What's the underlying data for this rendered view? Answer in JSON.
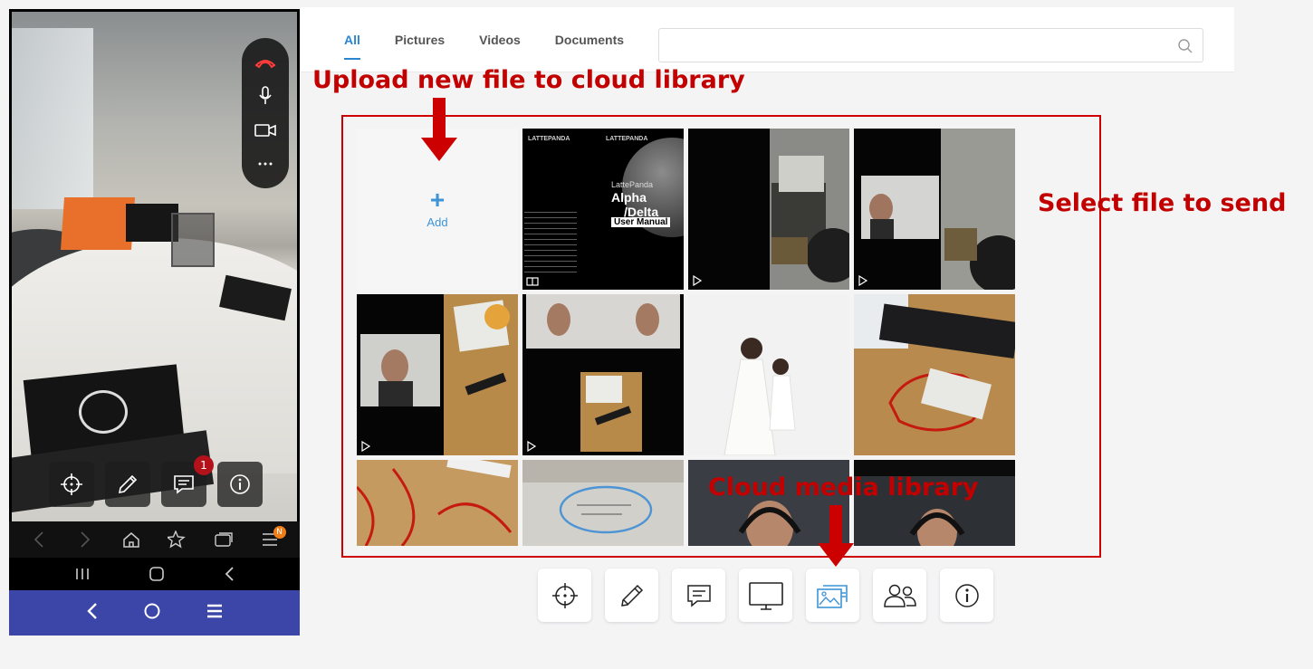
{
  "tabs": [
    {
      "label": "All",
      "active": true
    },
    {
      "label": "Pictures",
      "active": false
    },
    {
      "label": "Videos",
      "active": false
    },
    {
      "label": "Documents",
      "active": false
    }
  ],
  "search": {
    "placeholder": "",
    "value": ""
  },
  "add_tile": {
    "plus": "+",
    "label": "Add"
  },
  "document_tile": {
    "brand_left": "LATTEPANDA",
    "brand_right": "LATTEPANDA",
    "subtitle": "LattePanda",
    "title_line1": "Alpha",
    "title_line2": "/Delta",
    "badge": "User Manual"
  },
  "media_tiles": [
    {
      "type": "document"
    },
    {
      "type": "video"
    },
    {
      "type": "video"
    },
    {
      "type": "video"
    },
    {
      "type": "video"
    },
    {
      "type": "picture"
    },
    {
      "type": "picture"
    },
    {
      "type": "picture"
    },
    {
      "type": "picture"
    },
    {
      "type": "picture"
    },
    {
      "type": "picture"
    }
  ],
  "annotations": {
    "upload": "Upload new file to cloud library",
    "select": "Select file to send",
    "library": "Cloud media library"
  },
  "phone": {
    "chat_badge_count": "1",
    "browser_badge": "N"
  },
  "toolbar": [
    {
      "icon": "crosshair-icon",
      "active": false
    },
    {
      "icon": "pencil-icon",
      "active": false
    },
    {
      "icon": "chat-icon",
      "active": false
    },
    {
      "icon": "monitor-icon",
      "active": false
    },
    {
      "icon": "media-library-icon",
      "active": true
    },
    {
      "icon": "participants-icon",
      "active": false
    },
    {
      "icon": "info-icon",
      "active": false
    }
  ],
  "colors": {
    "accent": "#2a86d1",
    "annotation": "#c20000",
    "badge": "#b3121b",
    "nav_blue": "#3c45a8"
  }
}
